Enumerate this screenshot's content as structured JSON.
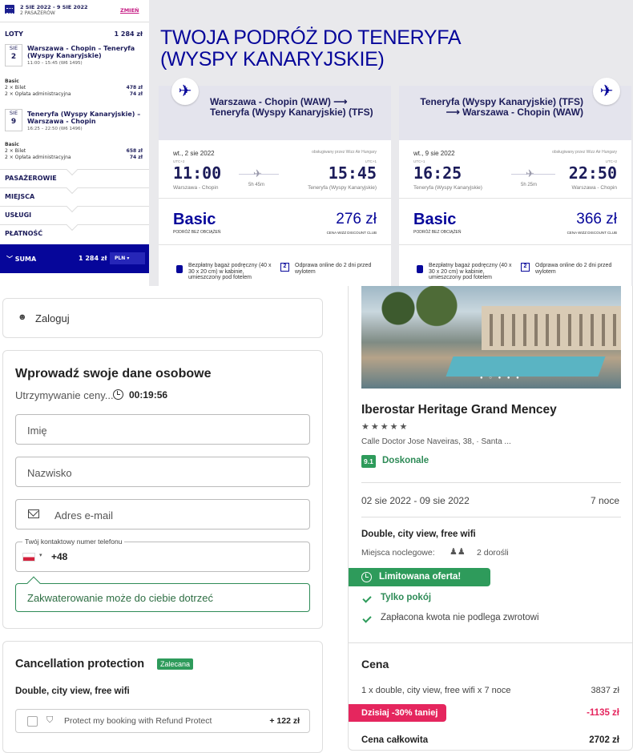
{
  "wizz": {
    "dates": "2 SIE 2022 - 9 SIE 2022",
    "passengers": "2 PASAŻERÓW",
    "change": "ZMIEŃ",
    "flights_label": "LOTY",
    "flights_total": "1 284 zł",
    "out": {
      "mon": "SIE",
      "day": "2",
      "route": "Warszawa - Chopin – Teneryfa (Wyspy Kanaryjskie)",
      "time": "11:00 – 15:45 (W6 1495)",
      "fare": "Basic",
      "ticket": "2 × Bilet",
      "ticket_p": "478 zł",
      "fee": "2 × Opłata administracyjna",
      "fee_p": "74 zł"
    },
    "ret": {
      "mon": "SIE",
      "day": "9",
      "route": "Teneryfa (Wyspy Kanaryjskie) – Warszawa - Chopin",
      "time": "16:25 – 22:50 (W6 1496)",
      "fare": "Basic",
      "ticket": "2 × Bilet",
      "ticket_p": "658 zł",
      "fee": "2 × Opłata administracyjna",
      "fee_p": "74 zł"
    },
    "sections": [
      "PASAŻEROWIE",
      "MIEJSCA",
      "USŁUGI",
      "PŁATNOŚĆ"
    ],
    "suma_label": "SUMA",
    "suma": "1 284 zł",
    "currency": "PLN",
    "title": "TWOJA PODRÓŻ DO TENERYFA (WYSPY KANARYJSKIE)",
    "card1": {
      "route": "Warszawa - Chopin (WAW) ⟶ Teneryfa (Wyspy Kanaryjskie) (TFS)",
      "date": "wt., 2 sie 2022",
      "operator": "obsługiwany przez Wizz Air Hungary",
      "utc1": "UTC+2",
      "utc2": "UTC+1",
      "dep": "11:00",
      "arr": "15:45",
      "dep_ap": "Warszawa - Chopin",
      "arr_ap": "Teneryfa (Wyspy Kanaryjskie)",
      "dur": "5h 45m",
      "fare": "Basic",
      "fare_sub": "PODRÓŻ BEZ OBCIĄŻEŃ",
      "price": "276 zł",
      "price_sub": "CENA WIZZ DISCOUNT CLUB",
      "bag": "Bezpłatny bagaż podręczny (40 x 30 x 20 cm) w kabinie, umieszczony pod fotelem",
      "checkin_num": "2",
      "checkin": "Odprawa online do 2 dni przed wylotem"
    },
    "card2": {
      "route": "Teneryfa (Wyspy Kanaryjskie) (TFS) ⟶ Warszawa - Chopin (WAW)",
      "date": "wt., 9 sie 2022",
      "operator": "obsługiwany przez Wizz Air Hungary",
      "utc1": "UTC+1",
      "utc2": "UTC+2",
      "dep": "16:25",
      "arr": "22:50",
      "dep_ap": "Teneryfa (Wyspy Kanaryjskie)",
      "arr_ap": "Warszawa - Chopin",
      "dur": "5h 25m",
      "fare": "Basic",
      "fare_sub": "PODRÓŻ BEZ OBCIĄŻEŃ",
      "price": "366 zł",
      "price_sub": "CENA WIZZ DISCOUNT CLUB",
      "bag": "Bezpłatny bagaż podręczny (40 x 30 x 20 cm) w kabinie, umieszczony pod fotelem",
      "checkin_num": "2",
      "checkin": "Odprawa online do 2 dni przed wylotem"
    }
  },
  "login": {
    "label": "Zaloguj"
  },
  "form": {
    "title": "Wprowadź swoje dane osobowe",
    "hold": "Utrzymywanie ceny...",
    "timer": "00:19:56",
    "first_name": "Imię",
    "last_name": "Nazwisko",
    "email": "Adres e-mail",
    "phone_label": "Twój kontaktowy numer telefonu",
    "phone_prefix": "+48",
    "hint": "Zakwaterowanie może do ciebie dotrzeć"
  },
  "cancel": {
    "title": "Cancellation protection",
    "badge": "Zalecana",
    "room": "Double, city view, free wifi",
    "option": "Protect my booking with Refund Protect",
    "price": "+ 122 zł"
  },
  "hotel": {
    "name": "Iberostar Heritage Grand Mencey",
    "stars": "★★★★★",
    "address": "Calle Doctor Jose Naveiras, 38, · Santa ...",
    "score": "9.1",
    "score_label": "Doskonale",
    "dates": "02 sie 2022 - 09 sie 2022",
    "nights": "7 noce",
    "room": "Double, city view, free wifi",
    "beds_label": "Miejsca noclegowe:",
    "beds": "2 dorośli",
    "limited": "Limitowana oferta!",
    "only_room": "Tylko pokój",
    "nonrefund": "Zapłacona kwota nie podlega zwrotowi",
    "price_title": "Cena",
    "line": "1 x double, city view, free wifi x 7 noce",
    "line_price": "3837 zł",
    "discount": "Dzisiaj -30% taniej",
    "discount_price": "-1135 zł",
    "total": "Cena całkowita",
    "total_price": "2702 zł"
  }
}
